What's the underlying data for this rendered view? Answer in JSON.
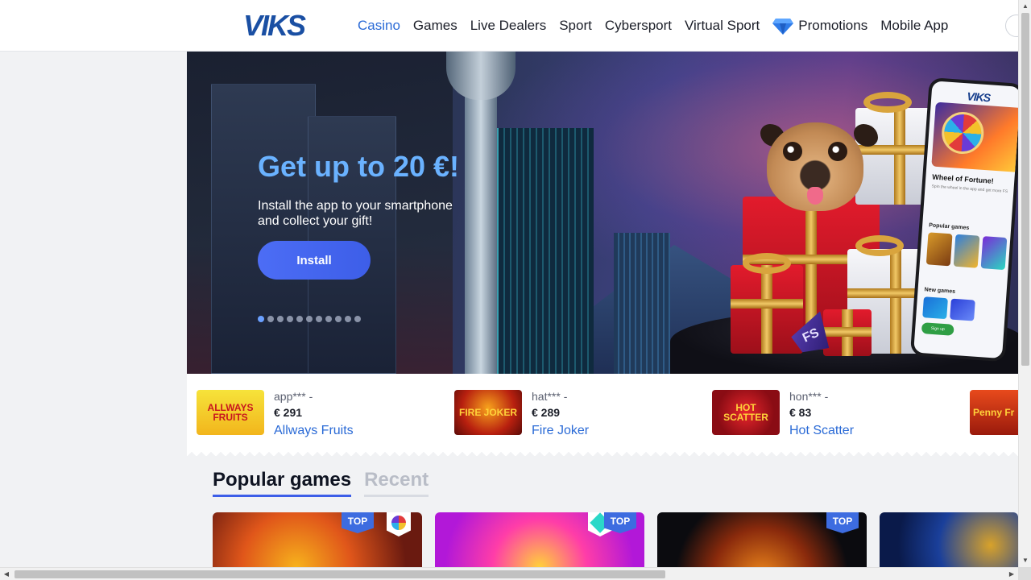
{
  "header": {
    "logo_text": "VIKS",
    "nav": [
      {
        "label": "Casino",
        "active": true
      },
      {
        "label": "Games"
      },
      {
        "label": "Live Dealers"
      },
      {
        "label": "Sport"
      },
      {
        "label": "Cybersport"
      },
      {
        "label": "Virtual Sport"
      },
      {
        "label": "Promotions",
        "icon": "diamond-icon"
      },
      {
        "label": "Mobile App"
      }
    ]
  },
  "hero": {
    "title": "Get up to 20 €!",
    "subtitle": "Install the app to your smartphone and collect your gift!",
    "button_label": "Install",
    "slide_count": 11,
    "active_slide": 1,
    "badge_text": "FS",
    "phone": {
      "logo": "VIKS",
      "title": "Wheel of Fortune!",
      "subtitle": "Spin the wheel in the app and get more FS",
      "popular_label": "Popular games",
      "new_label": "New games",
      "sign_in": "Sign up"
    }
  },
  "winners": [
    {
      "user": "app*** -",
      "amount": "€ 291",
      "game": "Allways Fruits",
      "thumb_text": "ALLWAYS FRUITS"
    },
    {
      "user": "hat*** -",
      "amount": "€ 289",
      "game": "Fire Joker",
      "thumb_text": "FIRE JOKER"
    },
    {
      "user": "hon*** -",
      "amount": "€ 83",
      "game": "Hot Scatter",
      "thumb_text": "HOT SCATTER"
    },
    {
      "thumb_text": "Penny Fr"
    }
  ],
  "tabs": [
    {
      "label": "Popular games",
      "active": true
    },
    {
      "label": "Recent",
      "active": false
    }
  ],
  "cards": [
    {
      "badge": "TOP",
      "provider": true
    },
    {
      "badge": "TOP",
      "provider": true
    },
    {
      "badge": "TOP",
      "provider": false
    },
    {
      "badge": "",
      "provider": false
    }
  ],
  "colors": {
    "accent": "#2a6ad6",
    "button": "#3d5ee8",
    "hero_title": "#6ab2ff",
    "top_badge": "#3d6ce0"
  }
}
